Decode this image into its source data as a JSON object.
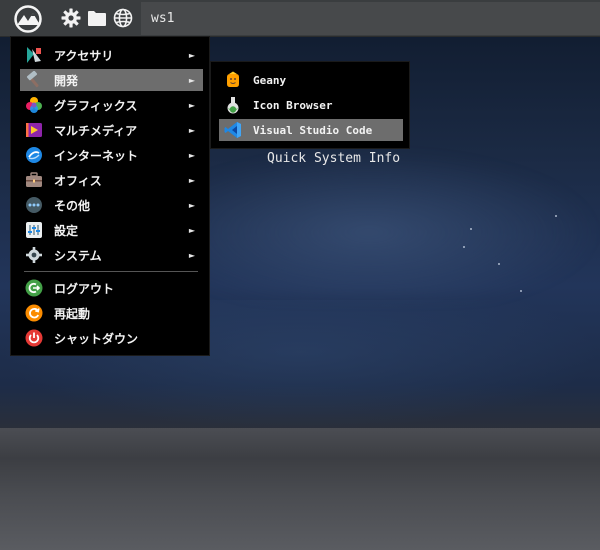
{
  "panel": {
    "workspace": "ws1",
    "icons": [
      "app-menu-logo-icon",
      "gear-icon",
      "folder-icon",
      "globe-icon"
    ]
  },
  "menu": {
    "items": [
      {
        "label": "アクセサリ",
        "icon": "accessories-icon",
        "arrow": "►"
      },
      {
        "label": "開発",
        "icon": "development-icon",
        "arrow": "►",
        "active": true
      },
      {
        "label": "グラフィックス",
        "icon": "graphics-icon",
        "arrow": "►"
      },
      {
        "label": "マルチメディア",
        "icon": "multimedia-icon",
        "arrow": "►"
      },
      {
        "label": "インターネット",
        "icon": "internet-icon",
        "arrow": "►"
      },
      {
        "label": "オフィス",
        "icon": "office-icon",
        "arrow": "►"
      },
      {
        "label": "その他",
        "icon": "other-icon",
        "arrow": "►"
      },
      {
        "label": "設定",
        "icon": "settings-icon",
        "arrow": "►"
      },
      {
        "label": "システム",
        "icon": "system-icon",
        "arrow": "►"
      },
      {
        "label": "ログアウト",
        "icon": "logout-icon"
      },
      {
        "label": "再起動",
        "icon": "reboot-icon"
      },
      {
        "label": "シャットダウン",
        "icon": "shutdown-icon"
      }
    ]
  },
  "submenu": {
    "items": [
      {
        "label": "Geany",
        "icon": "geany-icon"
      },
      {
        "label": "Icon Browser",
        "icon": "icon-browser-icon"
      },
      {
        "label": "Visual Studio Code",
        "icon": "vscode-icon",
        "active": true
      }
    ]
  },
  "desktop": {
    "quick_info": "Quick System Info"
  },
  "colors": {
    "panel": "#3a3d3f",
    "workspace": "#47494b",
    "menu_bg": "#000000",
    "highlight": "#6d6d6d"
  }
}
